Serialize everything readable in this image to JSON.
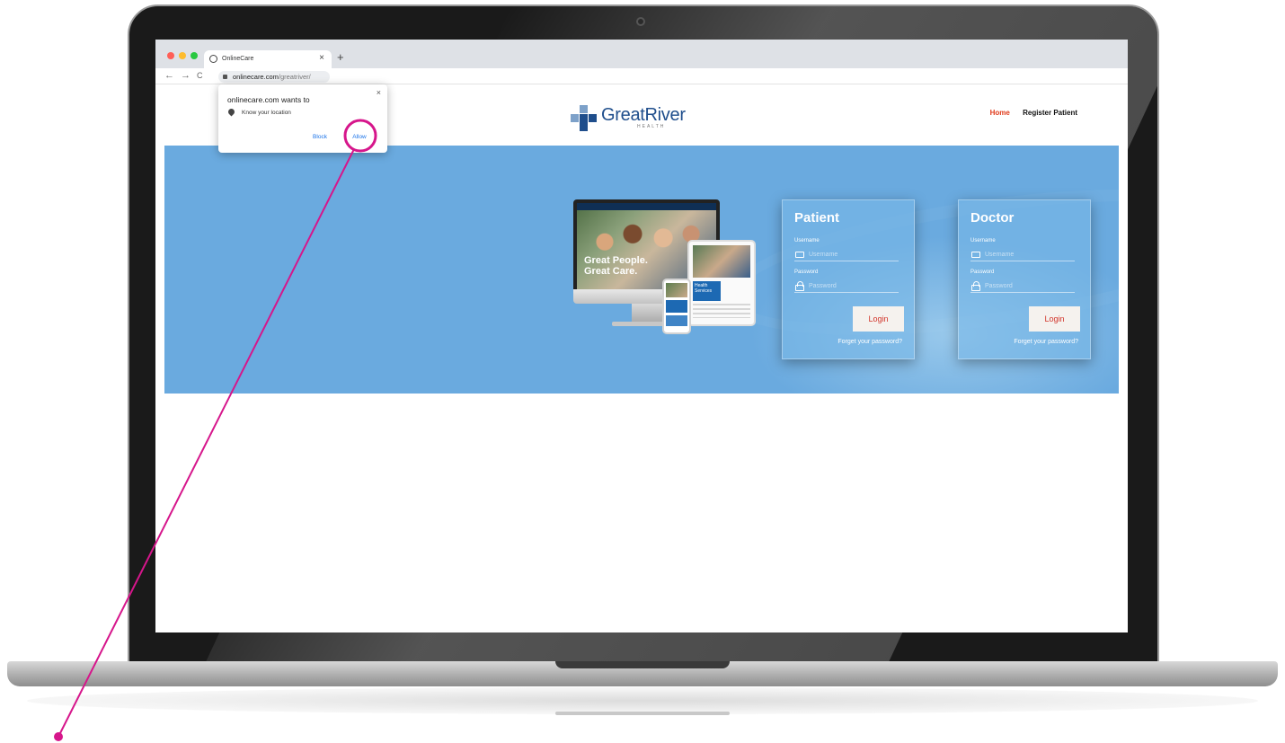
{
  "browser": {
    "tab_title": "OnlineCare",
    "tab_close": "×",
    "new_tab": "+",
    "back": "←",
    "forward": "→",
    "reload": "C",
    "url_host": "onlinecare.com",
    "url_path": "/greatriver/"
  },
  "permission_popup": {
    "title": "onlinecare.com wants to",
    "close": "×",
    "permission": "Know your location",
    "block_label": "Block",
    "allow_label": "Allow"
  },
  "header": {
    "logo_name": "GreatRiver",
    "logo_sub": "HEALTH",
    "nav": {
      "home": "Home",
      "register": "Register Patient"
    }
  },
  "hero": {
    "device_headline_1": "Great People.",
    "device_headline_2": "Great Care.",
    "device_tablet_text": "Health Services"
  },
  "patient_card": {
    "title": "Patient",
    "username_label": "Username",
    "username_placeholder": "Username",
    "password_label": "Password",
    "password_placeholder": "Password",
    "login_label": "Login",
    "forgot": "Forget your password?"
  },
  "doctor_card": {
    "title": "Doctor",
    "username_label": "Username",
    "username_placeholder": "Username",
    "password_label": "Password",
    "password_placeholder": "Password",
    "login_label": "Login",
    "forgot": "Forget your password?"
  },
  "colors": {
    "hero_bg": "#6aaadf",
    "brand_blue": "#1f4e8c",
    "nav_active": "#e03a1a",
    "login_text": "#d2352b",
    "annotation": "#d6168b"
  }
}
